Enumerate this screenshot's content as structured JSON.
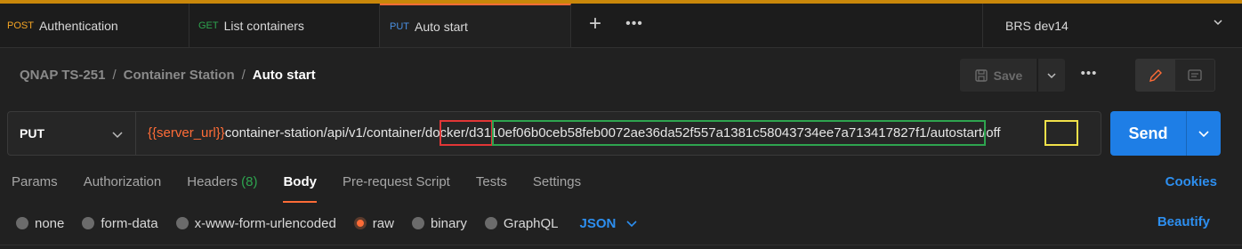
{
  "tabs": [
    {
      "method": "POST",
      "method_color": "#f5a524",
      "name": "Authentication"
    },
    {
      "method": "GET",
      "method_color": "#2ea44f",
      "name": "List containers"
    },
    {
      "method": "PUT",
      "method_color": "#4a90e2",
      "name": "Auto start"
    }
  ],
  "environment": {
    "name": "BRS dev14"
  },
  "breadcrumb": {
    "item1": "QNAP TS-251",
    "item2": "Container Station",
    "current": "Auto start",
    "separator": "/"
  },
  "toolbar": {
    "save_label": "Save"
  },
  "request": {
    "method": "PUT",
    "url_var": "{{server_url}}",
    "url_path": "container-station/api/v1/container",
    "url_segment_docker": "/docker/",
    "url_container_id": "d3110ef06b0ceb58feb0072ae36da52f557a1381c58043734ee7a713417827f1",
    "url_autostart": "/autostart/",
    "url_off": "off"
  },
  "send_label": "Send",
  "req_tabs": {
    "params": "Params",
    "authorization": "Authorization",
    "headers": "Headers",
    "headers_count": "(8)",
    "body": "Body",
    "prerequest": "Pre-request Script",
    "tests": "Tests",
    "settings": "Settings"
  },
  "cookies_label": "Cookies",
  "body_options": {
    "none": "none",
    "form_data": "form-data",
    "urlencoded": "x-www-form-urlencoded",
    "raw": "raw",
    "binary": "binary",
    "graphql": "GraphQL",
    "selected": "raw"
  },
  "language": "JSON",
  "beautify_label": "Beautify",
  "colors": {
    "accent": "#ff6c37",
    "primary": "#1e7ee6",
    "link": "#2d8ff0"
  },
  "highlights": [
    {
      "color": "#e23636"
    },
    {
      "color": "#2ea44f"
    },
    {
      "color": "#f2e14a"
    }
  ]
}
